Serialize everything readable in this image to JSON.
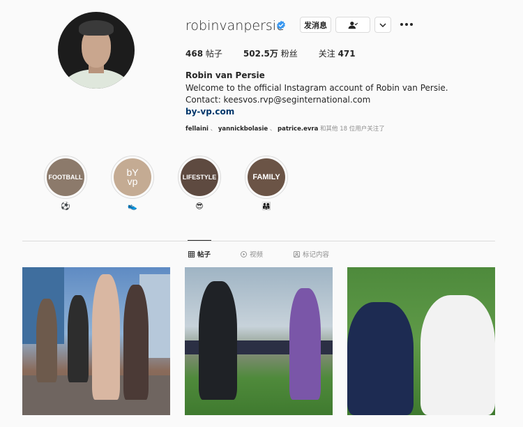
{
  "profile": {
    "username": "robinvanpersie",
    "verified_icon": "verified-badge-icon",
    "message_label": "发消息",
    "full_name": "Robin van Persie",
    "bio_line1": "Welcome to the official Instagram account of Robin van Persie.",
    "bio_line2": "Contact: keesvos.rvp@seginternational.com",
    "link": "by-vp.com",
    "followed_by": {
      "user1": "fellaini",
      "user2": "yannickbolasie",
      "user3": "patrice.evra",
      "sep": "、",
      "suffix": "和其他 18 位用户关注了"
    }
  },
  "stats": {
    "posts_count": "468",
    "posts_label": "帖子",
    "followers_count": "502.5万",
    "followers_label": "粉丝",
    "following_label": "关注",
    "following_count": "471"
  },
  "highlights": [
    {
      "title": "FOOTBALL",
      "emoji": "⚽",
      "bg": "#8c7a6b"
    },
    {
      "title": "bY\nvp",
      "emoji": "👟",
      "bg": "#c4ab93"
    },
    {
      "title": "LIFESTYLE",
      "emoji": "😎",
      "bg": "#5e4a40"
    },
    {
      "title": "FAMILY",
      "emoji": "👨‍👩‍👧",
      "bg": "#6b5446"
    }
  ],
  "tabs": [
    {
      "label": "帖子",
      "icon": "grid-icon"
    },
    {
      "label": "视频",
      "icon": "play-icon"
    },
    {
      "label": "标记内容",
      "icon": "tag-icon"
    }
  ],
  "colors": {
    "link": "#00376b",
    "verified": "#3897f0",
    "border": "#dbdbdb"
  }
}
